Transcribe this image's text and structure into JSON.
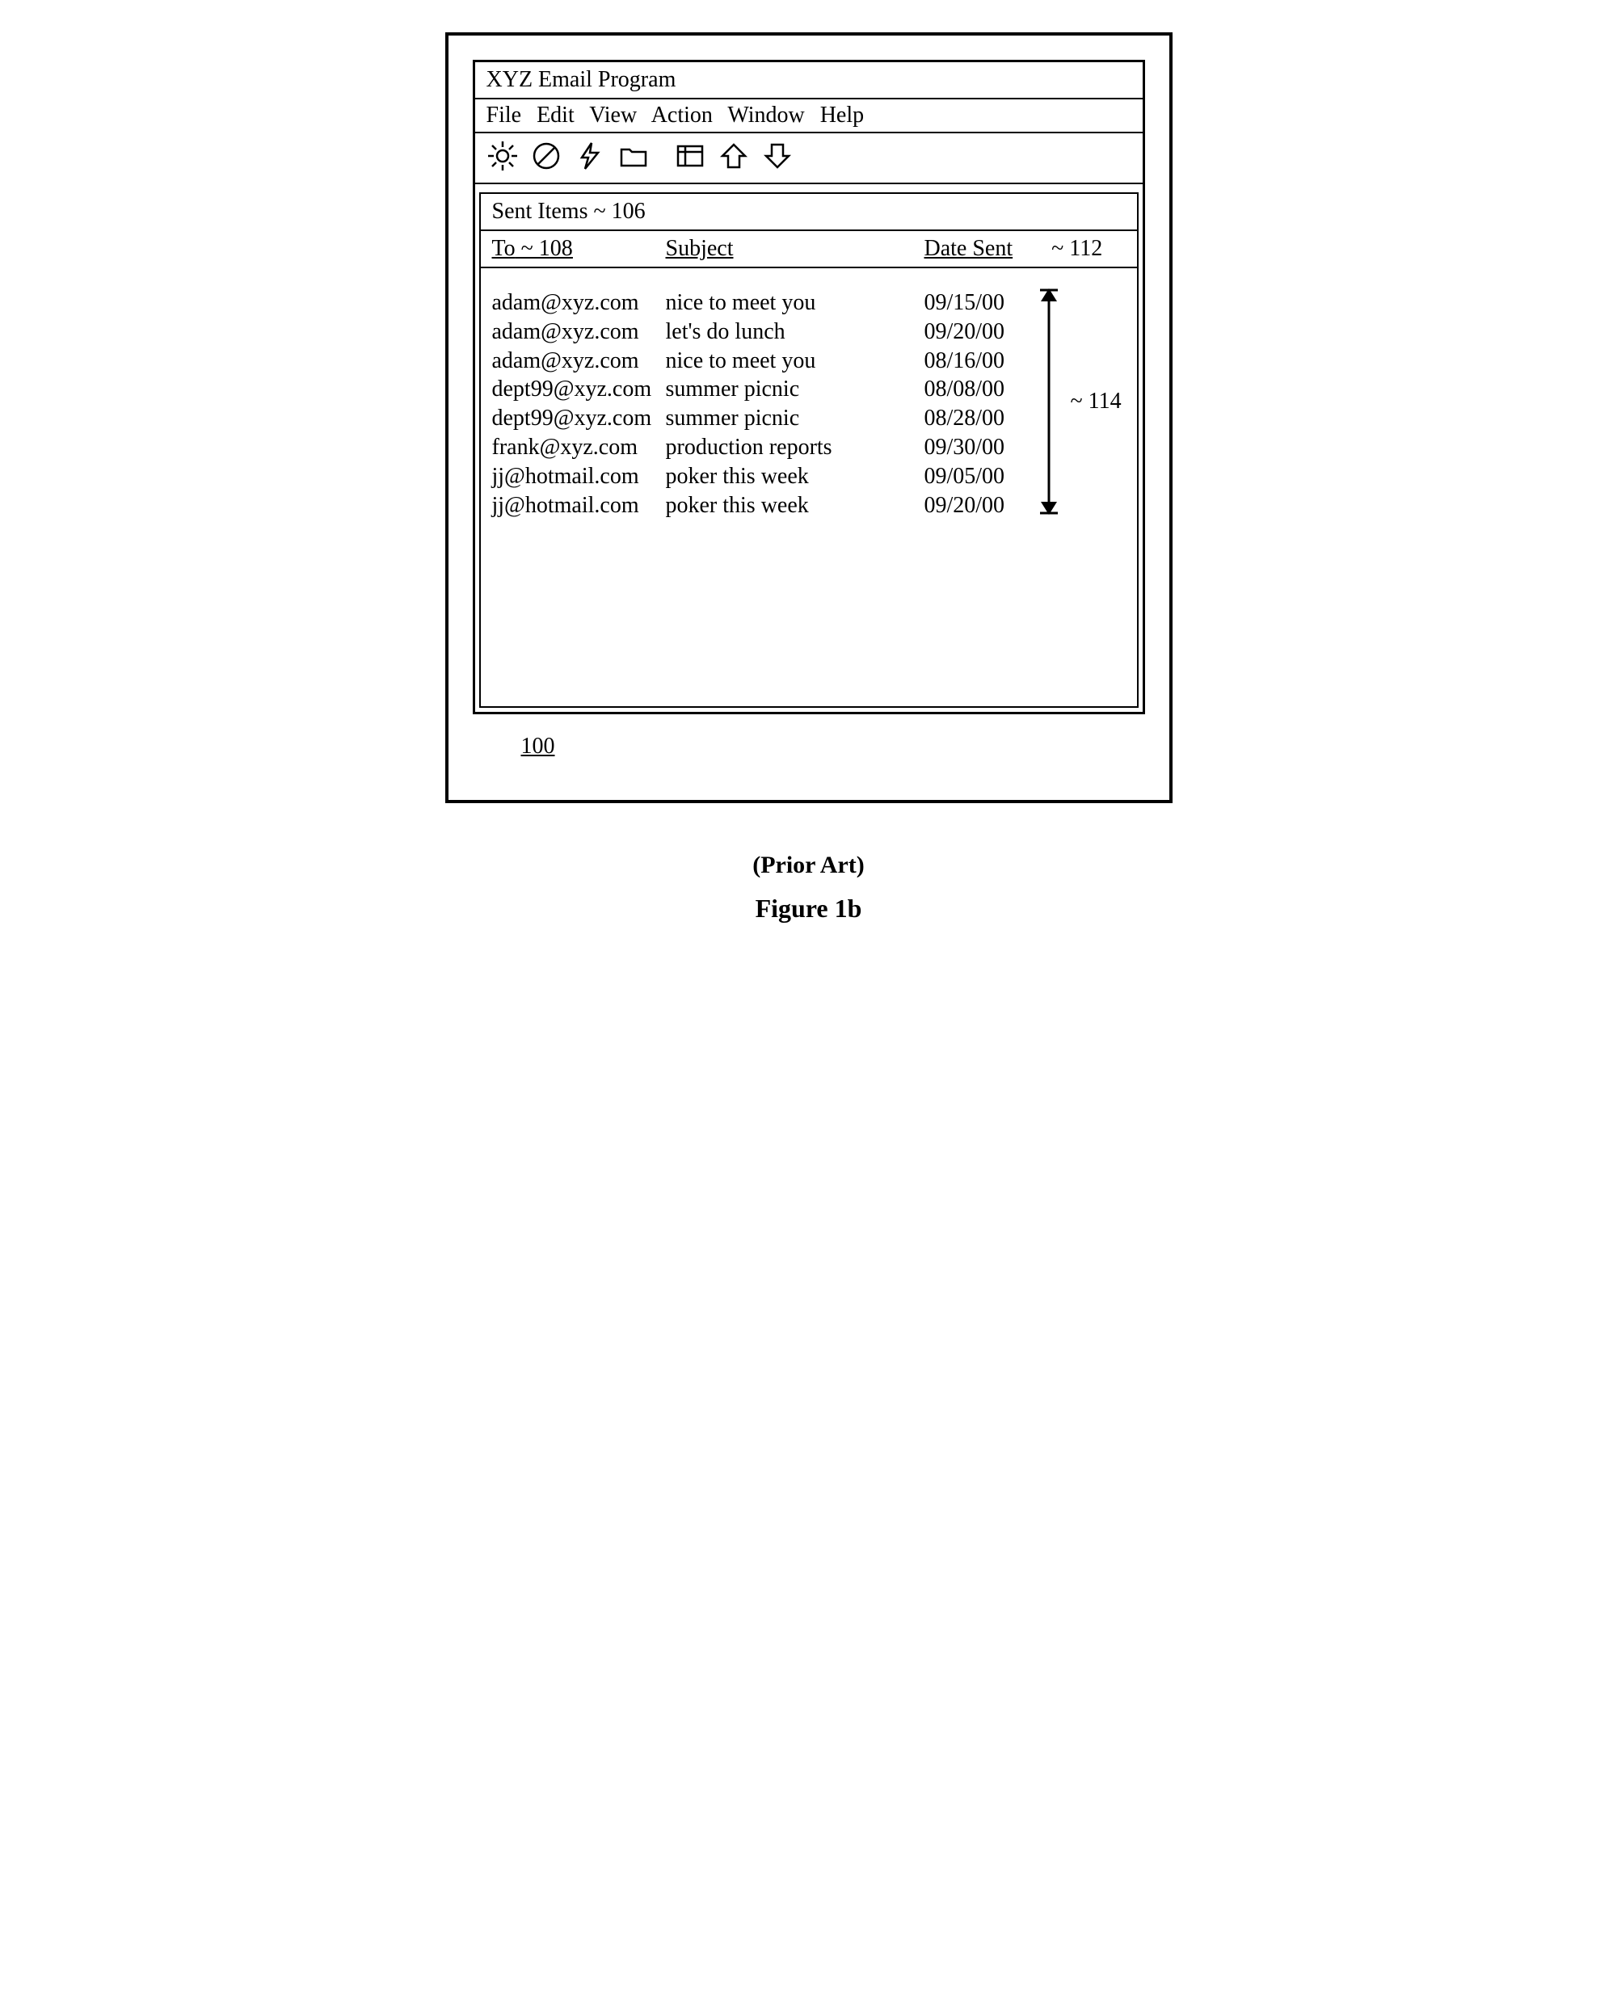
{
  "app": {
    "title": "XYZ Email Program"
  },
  "menu": {
    "file": "File",
    "edit": "Edit",
    "view": "View",
    "action": "Action",
    "window": "Window",
    "help": "Help"
  },
  "toolbar_icons": {
    "sun": "sun-icon",
    "no": "no-entry-icon",
    "lightning": "lightning-icon",
    "folder1": "folder-icon",
    "folder2": "window-icon",
    "up": "up-arrow-icon",
    "down": "down-arrow-icon"
  },
  "folder": {
    "label": "Sent Items",
    "ref": "~ 106"
  },
  "columns": {
    "to": "To",
    "to_ref": "~ 108",
    "subject": "Subject",
    "date": "Date Sent",
    "date_ref": "~ 112"
  },
  "rows": [
    {
      "to": "adam@xyz.com",
      "subject": "nice to meet you",
      "date": "09/15/00"
    },
    {
      "to": "adam@xyz.com",
      "subject": "let's do lunch",
      "date": "09/20/00"
    },
    {
      "to": "adam@xyz.com",
      "subject": "nice to meet you",
      "date": "08/16/00"
    },
    {
      "to": "dept99@xyz.com",
      "subject": "summer picnic",
      "date": "08/08/00"
    },
    {
      "to": "dept99@xyz.com",
      "subject": "summer picnic",
      "date": "08/28/00"
    },
    {
      "to": "frank@xyz.com",
      "subject": "production reports",
      "date": "09/30/00"
    },
    {
      "to": "jj@hotmail.com",
      "subject": "poker this week",
      "date": "09/05/00"
    },
    {
      "to": "jj@hotmail.com",
      "subject": "poker this week",
      "date": "09/20/00"
    }
  ],
  "annotations": {
    "ref114": "~ 114",
    "ref100": "100"
  },
  "caption": {
    "prior_art": "(Prior Art)",
    "figure": "Figure 1b"
  }
}
